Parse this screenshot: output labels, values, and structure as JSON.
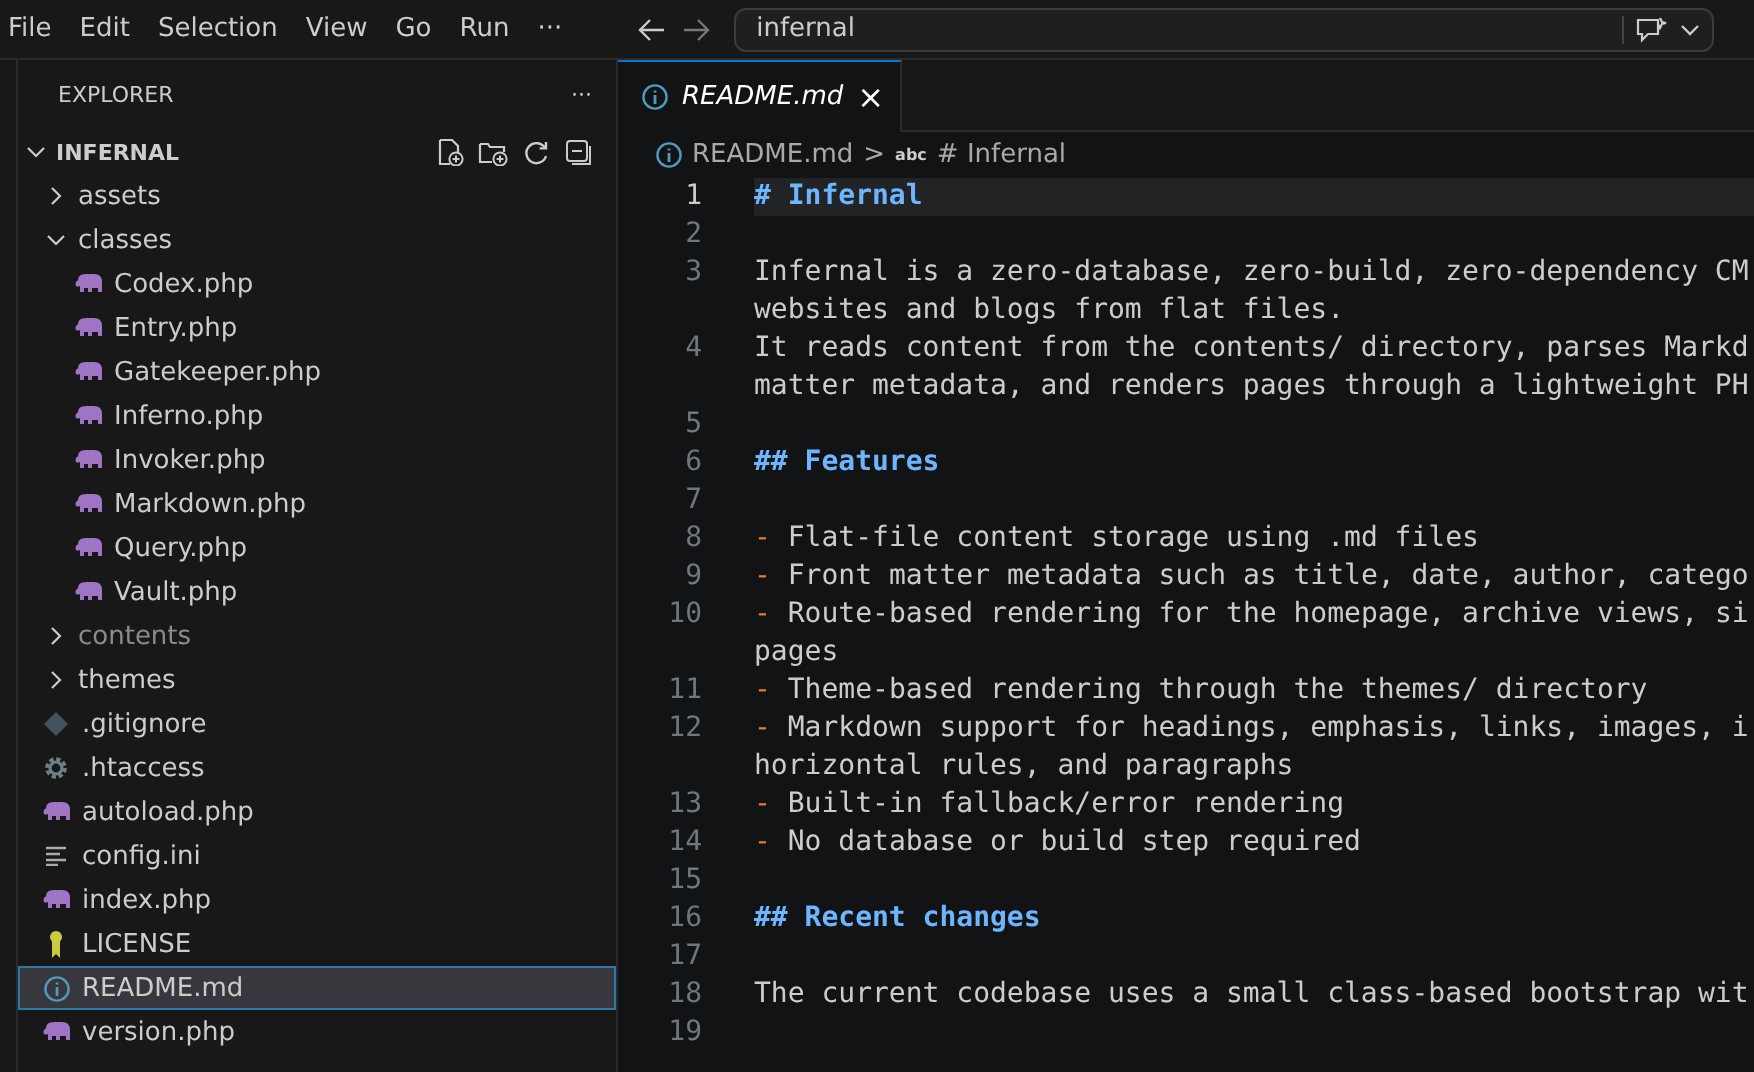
{
  "menu": [
    "File",
    "Edit",
    "Selection",
    "View",
    "Go",
    "Run",
    "···"
  ],
  "search": {
    "value": "infernal"
  },
  "explorer": {
    "title": "EXPLORER",
    "more": "···",
    "root": {
      "label": "INFERNAL",
      "expanded": true
    },
    "items": [
      {
        "label": "assets",
        "kind": "folder",
        "expanded": false,
        "dimmed": false,
        "selected": false
      },
      {
        "label": "classes",
        "kind": "folder",
        "expanded": true,
        "dimmed": false,
        "selected": false,
        "children": [
          {
            "label": "Codex.php",
            "kind": "php",
            "selected": false
          },
          {
            "label": "Entry.php",
            "kind": "php",
            "selected": false
          },
          {
            "label": "Gatekeeper.php",
            "kind": "php",
            "selected": false
          },
          {
            "label": "Inferno.php",
            "kind": "php",
            "selected": false
          },
          {
            "label": "Invoker.php",
            "kind": "php",
            "selected": false
          },
          {
            "label": "Markdown.php",
            "kind": "php",
            "selected": false
          },
          {
            "label": "Query.php",
            "kind": "php",
            "selected": false
          },
          {
            "label": "Vault.php",
            "kind": "php",
            "selected": false
          }
        ]
      },
      {
        "label": "contents",
        "kind": "folder",
        "expanded": false,
        "dimmed": true,
        "selected": false
      },
      {
        "label": "themes",
        "kind": "folder",
        "expanded": false,
        "dimmed": false,
        "selected": false
      },
      {
        "label": ".gitignore",
        "kind": "git",
        "selected": false
      },
      {
        "label": ".htaccess",
        "kind": "config",
        "selected": false
      },
      {
        "label": "autoload.php",
        "kind": "php",
        "selected": false
      },
      {
        "label": "config.ini",
        "kind": "text",
        "selected": false
      },
      {
        "label": "index.php",
        "kind": "php",
        "selected": false
      },
      {
        "label": "LICENSE",
        "kind": "license",
        "selected": false
      },
      {
        "label": "README.md",
        "kind": "info",
        "selected": true
      },
      {
        "label": "version.php",
        "kind": "php",
        "selected": false
      }
    ]
  },
  "tab": {
    "label": "README.md",
    "close": "×"
  },
  "breadcrumb": {
    "file": "README.md",
    "separator": ">",
    "symbol_icon": "abc",
    "symbol": "# Infernal"
  },
  "lines": [
    {
      "number": "1",
      "kind": "heading",
      "marker": "#",
      "rows": [
        "Infernal"
      ],
      "current": true
    },
    {
      "number": "2",
      "kind": "blank",
      "current": false
    },
    {
      "number": "3",
      "kind": "text",
      "rows": [
        "Infernal is a zero-database, zero-build, zero-dependency CM",
        "websites and blogs from flat files."
      ],
      "current": false
    },
    {
      "number": "4",
      "kind": "text",
      "rows": [
        "It reads content from the contents/ directory, parses Markd",
        "matter metadata, and renders pages through a lightweight PH"
      ],
      "current": false
    },
    {
      "number": "5",
      "kind": "blank",
      "current": false
    },
    {
      "number": "6",
      "kind": "heading",
      "marker": "##",
      "rows": [
        "Features"
      ],
      "current": false
    },
    {
      "number": "7",
      "kind": "blank",
      "current": false
    },
    {
      "number": "8",
      "kind": "bullet",
      "marker": "-",
      "rows": [
        "Flat-file content storage using .md files"
      ],
      "current": false
    },
    {
      "number": "9",
      "kind": "bullet",
      "marker": "-",
      "rows": [
        "Front matter metadata such as title, date, author, catego"
      ],
      "current": false
    },
    {
      "number": "10",
      "kind": "bullet",
      "marker": "-",
      "rows": [
        "Route-based rendering for the homepage, archive views, si",
        "pages"
      ],
      "current": false
    },
    {
      "number": "11",
      "kind": "bullet",
      "marker": "-",
      "rows": [
        "Theme-based rendering through the themes/ directory"
      ],
      "current": false
    },
    {
      "number": "12",
      "kind": "bullet",
      "marker": "-",
      "rows": [
        "Markdown support for headings, emphasis, links, images, i",
        "horizontal rules, and paragraphs"
      ],
      "current": false
    },
    {
      "number": "13",
      "kind": "bullet",
      "marker": "-",
      "rows": [
        "Built-in fallback/error rendering"
      ],
      "current": false
    },
    {
      "number": "14",
      "kind": "bullet",
      "marker": "-",
      "rows": [
        "No database or build step required"
      ],
      "current": false
    },
    {
      "number": "15",
      "kind": "blank",
      "current": false
    },
    {
      "number": "16",
      "kind": "heading",
      "marker": "##",
      "rows": [
        "Recent changes"
      ],
      "current": false
    },
    {
      "number": "17",
      "kind": "blank",
      "current": false
    },
    {
      "number": "18",
      "kind": "text",
      "rows": [
        "The current codebase uses a small class-based bootstrap wit"
      ],
      "current": false
    },
    {
      "number": "19",
      "kind": "blank",
      "current": false
    }
  ]
}
